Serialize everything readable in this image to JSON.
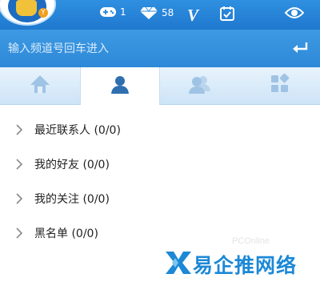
{
  "header": {
    "stats": [
      {
        "icon": "gamepad-icon",
        "value": "1"
      },
      {
        "icon": "diamond-icon",
        "value": "58"
      },
      {
        "icon": "v-badge-icon",
        "value": "V"
      },
      {
        "icon": "calendar-check-icon",
        "value": ""
      },
      {
        "icon": "eye-icon",
        "value": ""
      }
    ]
  },
  "search": {
    "placeholder": "输入频道号回车进入",
    "enter_icon": "enter-return-icon"
  },
  "tabs": [
    {
      "icon": "home-icon",
      "active": false
    },
    {
      "icon": "person-icon",
      "active": true
    },
    {
      "icon": "people-icon",
      "active": false
    },
    {
      "icon": "apps-grid-icon",
      "active": false
    }
  ],
  "list": [
    {
      "label": "最近联系人 (0/0)"
    },
    {
      "label": "我的好友 (0/0)"
    },
    {
      "label": "我的关注 (0/0)"
    },
    {
      "label": "黑名单 (0/0)"
    }
  ],
  "watermark": {
    "text": "易企推网络",
    "ghost": "PCOnline"
  },
  "colors": {
    "header_blue": "#2f8fe0",
    "search_blue": "#3a96e2",
    "tab_bg": "#dcecf9",
    "icon_blue": "#2f6fb0",
    "watermark_blue": "#1c88d6"
  }
}
